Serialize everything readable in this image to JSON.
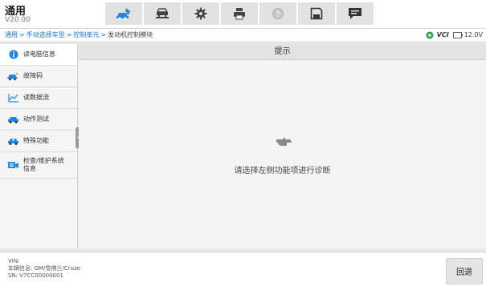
{
  "header": {
    "title": "通用",
    "version": "V20.00"
  },
  "toolbar": {
    "buttons": [
      {
        "icon": "home-car-icon"
      },
      {
        "icon": "vehicle-lift-icon"
      },
      {
        "icon": "settings-gear-icon"
      },
      {
        "icon": "printer-icon"
      },
      {
        "icon": "help-icon"
      },
      {
        "icon": "save-icon"
      },
      {
        "icon": "message-icon"
      }
    ]
  },
  "breadcrumb": {
    "items": [
      "通用",
      "手动选择车型",
      "控制单元"
    ],
    "separator": ">",
    "current": "发动机控制模块"
  },
  "status": {
    "vci_label": "VCI",
    "voltage": "12.0V"
  },
  "sidebar": {
    "items": [
      {
        "label": "读电脑信息",
        "icon": "info-icon"
      },
      {
        "label": "故障码",
        "icon": "dtc-car-icon"
      },
      {
        "label": "读数据流",
        "icon": "data-stream-icon"
      },
      {
        "label": "动作测试",
        "icon": "actuation-test-icon"
      },
      {
        "label": "特殊功能",
        "icon": "special-function-icon"
      },
      {
        "label": "检查/维护系统信息",
        "icon": "maintenance-icon"
      }
    ]
  },
  "main": {
    "header": "提示",
    "hint": "请选择左侧功能项进行诊断"
  },
  "footer": {
    "vin_label": "VIN:",
    "vehicle_info": "车辆信息: GM/雪佛兰/Cruze",
    "sn": "SN: V7CC00000001",
    "back_button": "回退"
  },
  "colors": {
    "link": "#1a73c9",
    "accent_blue": "#1e88e5",
    "toolbar_bg": "#e2e2e2"
  }
}
